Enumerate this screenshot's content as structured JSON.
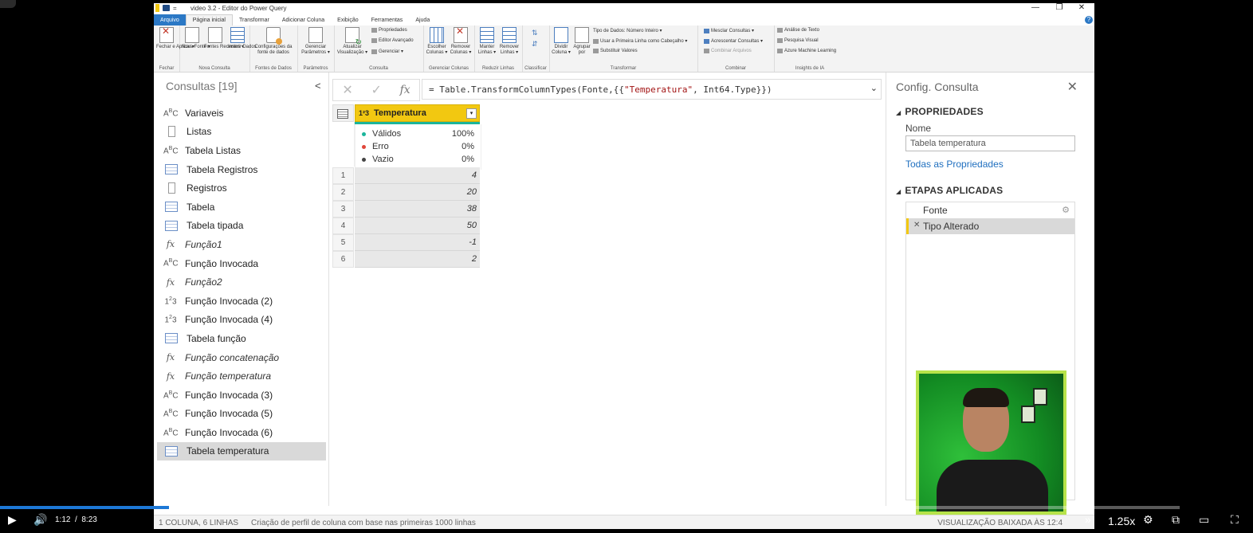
{
  "window": {
    "title": "video 3.2 - Editor do Power Query",
    "quick_access_caret": "=",
    "controls": [
      "—",
      "❐",
      "✕"
    ]
  },
  "tabs": [
    "Arquivo",
    "Página inicial",
    "Transformar",
    "Adicionar Coluna",
    "Exibição",
    "Ferramentas",
    "Ajuda"
  ],
  "ribbon": {
    "fechar": {
      "label": "Fechar e Aplicar ▾",
      "group": "Fechar"
    },
    "nova_consulta": {
      "buttons": [
        "Nova Fonte ▾",
        "Fontes Recentes ▾",
        "Inserir Dados"
      ],
      "group": "Nova Consulta"
    },
    "fontes": {
      "button": "Configurações da fonte de dados",
      "group": "Fontes de Dados"
    },
    "parametros": {
      "button": "Gerenciar Parâmetros ▾",
      "group": "Parâmetros"
    },
    "consulta": {
      "button": "Atualizar Visualização ▾",
      "small": [
        "Propriedades",
        "Editor Avançado",
        "Gerenciar ▾"
      ],
      "group": "Consulta"
    },
    "colunas": {
      "buttons": [
        "Escolher Colunas ▾",
        "Remover Colunas ▾"
      ],
      "group": "Gerenciar Colunas"
    },
    "linhas": {
      "buttons": [
        "Manter Linhas ▾",
        "Remover Linhas ▾"
      ],
      "group": "Reduzir Linhas"
    },
    "classificar": {
      "group": "Classificar"
    },
    "transformar": {
      "buttons": [
        "Dividir Coluna ▾",
        "Agrupar por"
      ],
      "small": [
        "Tipo de Dados: Número Inteiro ▾",
        "Usar a Primeira Linha como Cabeçalho ▾",
        "Substituir Valores"
      ],
      "group": "Transformar"
    },
    "combinar": {
      "small": [
        "Mesclar Consultas ▾",
        "Acrescentar Consultas ▾",
        "Combinar Arquivos"
      ],
      "group": "Combinar"
    },
    "ia": {
      "small": [
        "Análise de Texto",
        "Pesquisa Visual",
        "Azure Machine Learning"
      ],
      "group": "Insights de IA"
    }
  },
  "queries": {
    "title": "Consultas [19]",
    "collapse": "<",
    "items": [
      {
        "label": "Variaveis",
        "icon": "ABC"
      },
      {
        "label": "Listas",
        "icon": "list"
      },
      {
        "label": "Tabela Listas",
        "icon": "ABC"
      },
      {
        "label": "Tabela Registros",
        "icon": "table"
      },
      {
        "label": "Registros",
        "icon": "list"
      },
      {
        "label": "Tabela",
        "icon": "table"
      },
      {
        "label": "Tabela tipada",
        "icon": "table"
      },
      {
        "label": "Função1",
        "icon": "fx"
      },
      {
        "label": "Função Invocada",
        "icon": "ABC"
      },
      {
        "label": "Função2",
        "icon": "fx"
      },
      {
        "label": "Função Invocada (2)",
        "icon": "123"
      },
      {
        "label": "Função Invocada (4)",
        "icon": "123"
      },
      {
        "label": "Tabela função",
        "icon": "table"
      },
      {
        "label": "Função concatenação",
        "icon": "fx"
      },
      {
        "label": "Função temperatura",
        "icon": "fx"
      },
      {
        "label": "Função Invocada (3)",
        "icon": "ABC"
      },
      {
        "label": "Função Invocada (5)",
        "icon": "ABC"
      },
      {
        "label": "Função Invocada (6)",
        "icon": "ABC"
      },
      {
        "label": "Tabela temperatura",
        "icon": "table"
      }
    ]
  },
  "formula": {
    "prefix": "= Table.TransformColumnTypes(Fonte,{{",
    "string": "\"Temperatura\"",
    "suffix": ", Int64.Type}})"
  },
  "grid": {
    "column": "Temperatura",
    "type_icon": "1²3",
    "quality": [
      {
        "label": "Válidos",
        "value": "100%",
        "color": "#1bb59b"
      },
      {
        "label": "Erro",
        "value": "0%",
        "color": "#e0463a"
      },
      {
        "label": "Vazio",
        "value": "0%",
        "color": "#444444"
      }
    ],
    "rows": [
      {
        "n": "1",
        "v": "4"
      },
      {
        "n": "2",
        "v": "20"
      },
      {
        "n": "3",
        "v": "38"
      },
      {
        "n": "4",
        "v": "50"
      },
      {
        "n": "5",
        "v": "-1"
      },
      {
        "n": "6",
        "v": "2"
      }
    ]
  },
  "settings": {
    "title": "Config. Consulta",
    "props_header": "PROPRIEDADES",
    "name_label": "Nome",
    "name_value": "Tabela temperatura",
    "all_props": "Todas as Propriedades",
    "steps_header": "ETAPAS APLICADAS",
    "steps": [
      "Fonte",
      "Tipo Alterado"
    ]
  },
  "status": {
    "left": "1 COLUNA, 6 LINHAS",
    "middle": "Criação de perfil de coluna com base nas primeiras 1000 linhas",
    "right": "VISUALIZAÇÃO BAIXADA ÀS 12:4"
  },
  "player": {
    "current": "1:12",
    "separator": "/",
    "duration": "8:23",
    "speed": "1.25x",
    "progress": 0.143
  }
}
